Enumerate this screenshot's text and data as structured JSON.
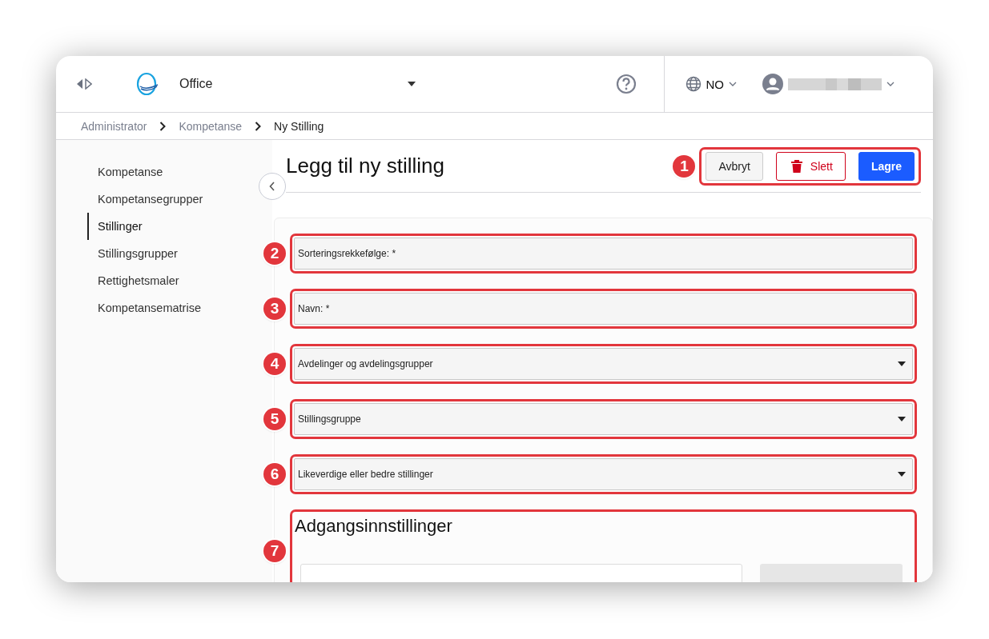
{
  "header": {
    "app_name": "Office",
    "language": "NO"
  },
  "breadcrumbs": [
    {
      "label": "Administrator",
      "current": false
    },
    {
      "label": "Kompetanse",
      "current": false
    },
    {
      "label": "Ny Stilling",
      "current": true
    }
  ],
  "sidebar": {
    "items": [
      {
        "label": "Kompetanse",
        "selected": false
      },
      {
        "label": "Kompetansegrupper",
        "selected": false
      },
      {
        "label": "Stillinger",
        "selected": true
      },
      {
        "label": "Stillingsgrupper",
        "selected": false
      },
      {
        "label": "Rettighetsmaler",
        "selected": false
      },
      {
        "label": "Kompetansematrise",
        "selected": false
      }
    ]
  },
  "page": {
    "title": "Legg til ny stilling",
    "callout": "1",
    "actions": [
      {
        "label": "Avbryt",
        "kind": "default"
      },
      {
        "label": "Slett",
        "kind": "danger"
      },
      {
        "label": "Lagre",
        "kind": "primary"
      }
    ]
  },
  "form": {
    "fields": [
      {
        "kind": "text",
        "placeholder": "Sorteringsrekkefølge: *",
        "callout": "2"
      },
      {
        "kind": "text",
        "placeholder": "Navn: *",
        "callout": "3"
      },
      {
        "kind": "select",
        "label": "Avdelinger og avdelingsgrupper",
        "callout": "4"
      },
      {
        "kind": "select",
        "label": "Stillingsgruppe",
        "callout": "5"
      },
      {
        "kind": "select",
        "label": "Likeverdige eller bedre stillinger",
        "callout": "6"
      }
    ],
    "section": {
      "title": "Adgangsinnstillinger",
      "callout": "7"
    }
  }
}
